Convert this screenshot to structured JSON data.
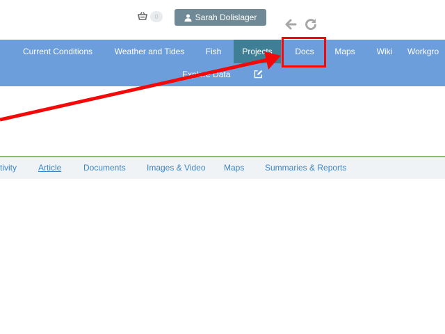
{
  "header": {
    "cart_count": "0",
    "user_name": "Sarah Dolislager"
  },
  "main_nav": {
    "items": [
      {
        "label": "Current Conditions"
      },
      {
        "label": "Weather and Tides"
      },
      {
        "label": "Fish"
      },
      {
        "label": "Projects"
      },
      {
        "label": "Docs"
      },
      {
        "label": "Maps"
      },
      {
        "label": "Wiki"
      },
      {
        "label": "Workgro"
      }
    ],
    "active": "Projects",
    "row2_label": "Explore Data"
  },
  "sub_nav": {
    "items": [
      {
        "label": "tivity"
      },
      {
        "label": "Article"
      },
      {
        "label": "Documents"
      },
      {
        "label": "Images & Video"
      },
      {
        "label": "Maps"
      },
      {
        "label": "Summaries & Reports"
      }
    ],
    "selected": "Article"
  },
  "colors": {
    "nav_bg": "#6c9edc",
    "nav_active": "#3f7f96",
    "user_button": "#6f8a96",
    "annotation": "#f20a0a",
    "link": "#3a86c8"
  },
  "icons": [
    "cart-icon",
    "user-icon",
    "back-arrow-icon",
    "refresh-icon",
    "edit-icon"
  ]
}
